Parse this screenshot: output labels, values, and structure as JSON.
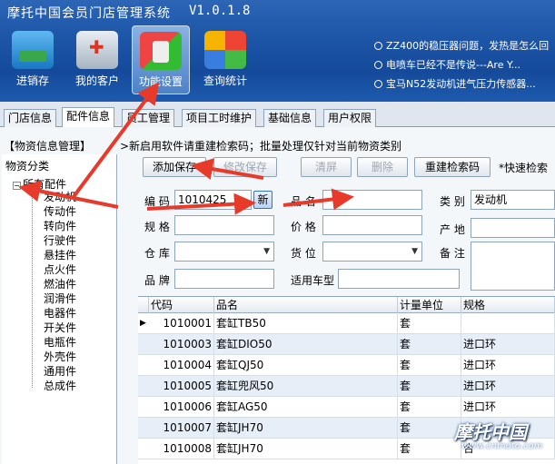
{
  "app": {
    "title": "摩托中国会员门店管理系统",
    "version": "V1.0.1.8"
  },
  "toolbar": {
    "buttons": [
      {
        "label": "进销存",
        "icon": "truck-icon"
      },
      {
        "label": "我的客户",
        "icon": "medical-kit-icon"
      },
      {
        "label": "功能设置",
        "icon": "usb-device-icon"
      },
      {
        "label": "查询统计",
        "icon": "windows-logo-icon"
      }
    ]
  },
  "news": [
    "ZZ400的稳压器问题，发热是怎么回",
    "电喷车已经不是传说---Are Y...",
    "宝马N52发动机进气压力传感器..."
  ],
  "tabs": [
    "门店信息",
    "配件信息",
    "员工管理",
    "项目工时维护",
    "基础信息",
    "用户权限"
  ],
  "panel": {
    "title": "【物资信息管理】",
    "hint": ">新启用软件请重建检索码；批量处理仅针对当前物资类别"
  },
  "tree": {
    "header": "物资分类",
    "root": "所有配件",
    "items": [
      "发动机",
      "传动件",
      "转向件",
      "行驶件",
      "悬挂件",
      "点火件",
      "燃油件",
      "润滑件",
      "电器件",
      "开关件",
      "电瓶件",
      "外壳件",
      "通用件",
      "总成件"
    ]
  },
  "actions": {
    "add_save": "添加保存",
    "modify_save": "修改保存",
    "clear": "清屏",
    "delete": "删除",
    "rebuild_index": "重建检索码",
    "quick_search": "*快速检索"
  },
  "form": {
    "code_label": "编 码",
    "code_value": "1010425",
    "new_label": "新",
    "name_label": "品 名",
    "name_value": "",
    "category_label": "类 别",
    "category_value": "发动机",
    "spec_label": "规 格",
    "price_label": "价 格",
    "origin_label": "产 地",
    "warehouse_label": "仓 库",
    "location_label": "货 位",
    "remark_label": "备 注",
    "brand_label": "品 牌",
    "model_label": "适用车型"
  },
  "grid": {
    "columns": [
      "代码",
      "品名",
      "计量单位",
      "规格"
    ],
    "rows": [
      {
        "code": "1010001",
        "name": "套缸TB50",
        "unit": "套",
        "spec": ""
      },
      {
        "code": "1010003",
        "name": "套缸DIO50",
        "unit": "套",
        "spec": "进口环"
      },
      {
        "code": "1010004",
        "name": "套缸QJ50",
        "unit": "套",
        "spec": "进口环"
      },
      {
        "code": "1010005",
        "name": "套缸兜风50",
        "unit": "套",
        "spec": "进口环"
      },
      {
        "code": "1010006",
        "name": "套缸AG50",
        "unit": "套",
        "spec": "进口环"
      },
      {
        "code": "1010007",
        "name": "套缸JH70",
        "unit": "套",
        "spec": ""
      },
      {
        "code": "1010008",
        "name": "套缸JH70",
        "unit": "套",
        "spec": "合"
      }
    ]
  },
  "watermark": {
    "text": "摩托中国",
    "url": "www.cnmoto.com"
  },
  "colors": {
    "header": "#1e56a8",
    "arrow": "#e83a2a",
    "row_alt": "#e6eef8"
  }
}
